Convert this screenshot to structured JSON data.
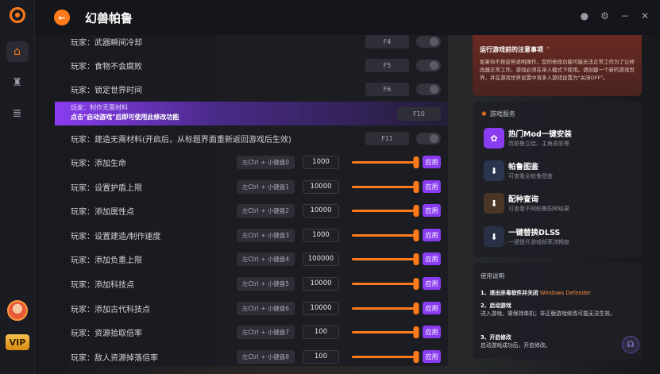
{
  "app": {
    "title": "幻兽帕鲁"
  },
  "sidebar": {
    "vip_label": "VIP"
  },
  "toggles": [
    {
      "label": "玩家：武器瞬间冷却",
      "hotkey": "F4"
    },
    {
      "label": "玩家：食物不会腐败",
      "hotkey": "F5"
    },
    {
      "label": "玩家：锁定世界时间",
      "hotkey": "F6"
    }
  ],
  "special": {
    "label": "玩家：制作无需材料",
    "hint": "点击\"启动游戏\"后即可使用此修改功能",
    "hotkey": "F10"
  },
  "build_toggle": {
    "label": "玩家：建造无需材料(开启后，从标题界面重新返回游戏后生效)",
    "hotkey": "F11"
  },
  "sliders": [
    {
      "label": "玩家：添加生命",
      "combo": "左Ctrl + 小键盘0",
      "value": "1000",
      "level": 0.98,
      "apply": "应用"
    },
    {
      "label": "玩家：设置护盾上限",
      "combo": "左Ctrl + 小键盘1",
      "value": "10000",
      "level": 0.98,
      "apply": "应用"
    },
    {
      "label": "玩家：添加属性点",
      "combo": "左Ctrl + 小键盘2",
      "value": "10000",
      "level": 0.98,
      "apply": "应用"
    },
    {
      "label": "玩家：设置建造/制作速度",
      "combo": "左Ctrl + 小键盘3",
      "value": "1000",
      "level": 0.98,
      "apply": "应用"
    },
    {
      "label": "玩家：添加负重上限",
      "combo": "左Ctrl + 小键盘4",
      "value": "100000",
      "level": 0.98,
      "apply": "应用"
    },
    {
      "label": "玩家：添加科技点",
      "combo": "左Ctrl + 小键盘5",
      "value": "10000",
      "level": 0.98,
      "apply": "应用"
    },
    {
      "label": "玩家：添加古代科技点",
      "combo": "左Ctrl + 小键盘6",
      "value": "10000",
      "level": 0.98,
      "apply": "应用"
    },
    {
      "label": "玩家：资源拾取倍率",
      "combo": "左Ctrl + 小键盘7",
      "value": "100",
      "level": 0.98,
      "apply": "应用"
    },
    {
      "label": "玩家：敌人资源掉落倍率",
      "combo": "左Ctrl + 小键盘8",
      "value": "100",
      "level": 0.98,
      "apply": "应用"
    }
  ],
  "notice": {
    "title": "运行游戏前的注意事项",
    "body": "如果你不按这些说明操作，您的修改功能可能无法正常工作为了让修改器正常工作，游戏必须在单人模式下使用。请创建一个新的游戏世界，并在游戏世界设置中将多人游戏设置为\"关闭OFF\"。"
  },
  "services": {
    "header": "游戏服务",
    "items": [
      {
        "title": "热门Mod一键安装",
        "desc": "改帕鲁立绘、主角皮肤等",
        "color": "#8a3cf0",
        "icon": "mod-icon"
      },
      {
        "title": "帕鲁图鉴",
        "desc": "可查看全帕鲁图鉴",
        "color": "#2a3550",
        "icon": "download-icon"
      },
      {
        "title": "配种查询",
        "desc": "可查看不同帕鲁配种结果",
        "color": "#4a3526",
        "icon": "download-icon"
      },
      {
        "title": "一键替换DLSS",
        "desc": "一键提升游戏帧率流畅度",
        "color": "#2a3045",
        "icon": "download-icon"
      }
    ]
  },
  "usage": {
    "header": "使用说明",
    "step1_title": "1、退出杀毒软件并关闭",
    "step1_hl": "Windows Defender",
    "step2_title": "2、启动游戏",
    "step2_body": "进入游戏，需保持单机；非正版游戏修改可能无法生效。",
    "step3_title": "3、开启修改",
    "step3_body": "启动游戏成功后，开启修改。"
  }
}
